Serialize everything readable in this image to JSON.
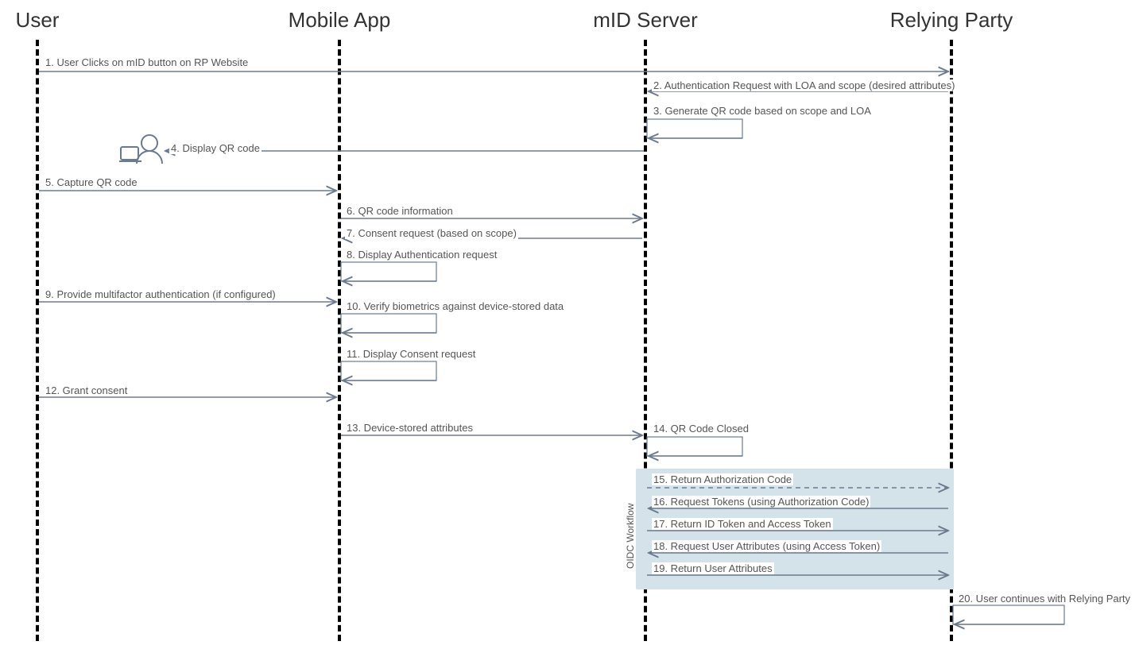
{
  "actors": {
    "user": "User",
    "app": "Mobile App",
    "mid": "mID Server",
    "rp": "Relying Party"
  },
  "messages": {
    "m1": "1. User Clicks on mID button on RP Website",
    "m2": "2. Authentication Request with LOA and scope (desired attributes)",
    "m3": "3. Generate QR code based on scope and LOA",
    "m4": "4. Display QR code",
    "m5": "5. Capture QR code",
    "m6": "6. QR code information",
    "m7": "7. Consent request (based on scope)",
    "m8": "8. Display Authentication request",
    "m9": "9. Provide multifactor authentication (if configured)",
    "m10": "10. Verify biometrics against device-stored data",
    "m11": "11. Display Consent request",
    "m12": "12. Grant consent",
    "m13": "13. Device-stored attributes",
    "m14": "14. QR Code Closed",
    "m15": "15. Return Authorization Code",
    "m16": "16. Request Tokens (using Authorization Code)",
    "m17": "17. Return ID Token and Access Token",
    "m18": "18. Request User Attributes (using Access Token)",
    "m19": "19. Return User Attributes",
    "m20": "20. User continues with Relying Party"
  },
  "group": {
    "oidc": "OIDC Workflow"
  },
  "colors": {
    "line": "#6b7a8f",
    "groupBg": "#d4e3e9"
  }
}
